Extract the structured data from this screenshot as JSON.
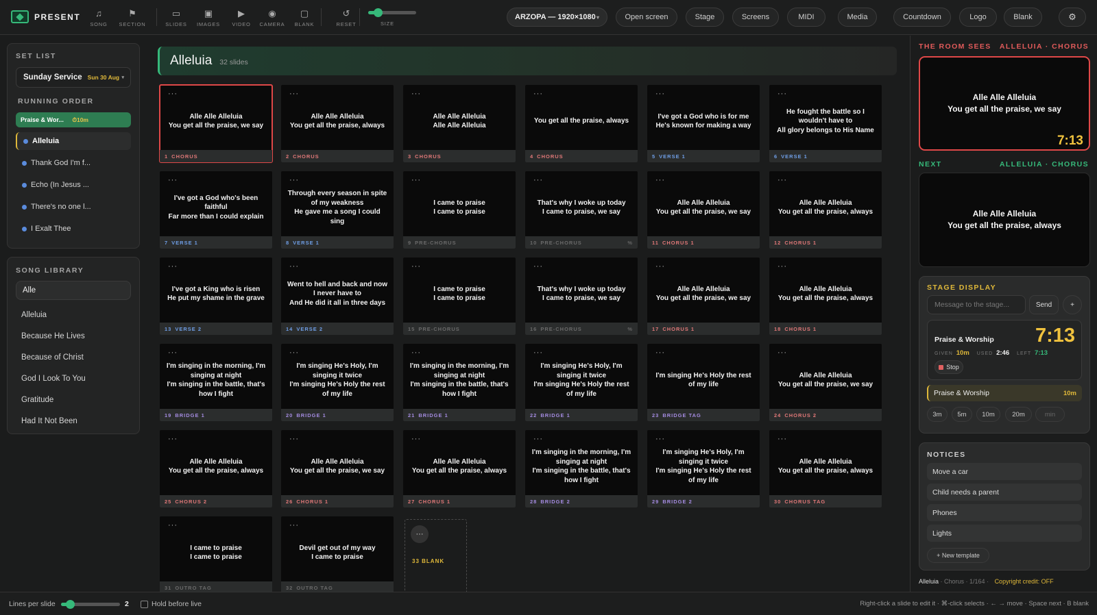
{
  "app": {
    "name": "PRESENT"
  },
  "toolbar": {
    "tools": [
      {
        "icon": "music-note-icon",
        "glyph": "♫",
        "label": "SONG"
      },
      {
        "icon": "flag-icon",
        "glyph": "⚑",
        "label": "SECTION"
      },
      {
        "icon": "monitor-icon",
        "glyph": "▭",
        "label": "SLIDES"
      },
      {
        "icon": "image-icon",
        "glyph": "▣",
        "label": "IMAGES"
      },
      {
        "icon": "video-icon",
        "glyph": "▶",
        "label": "VIDEO"
      },
      {
        "icon": "camera-icon",
        "glyph": "◉",
        "label": "CAMERA"
      },
      {
        "icon": "blank-screen-icon",
        "glyph": "▢",
        "label": "BLANK"
      },
      {
        "icon": "reset-icon",
        "glyph": "↺",
        "label": "RESET"
      }
    ],
    "size_label": "SIZE",
    "size_value": 0.2,
    "display_select": "ARZOPA — 1920×1080",
    "buttons": [
      "Open screen",
      "Stage",
      "Screens",
      "MIDI",
      "Media",
      "Countdown",
      "Logo",
      "Blank"
    ],
    "settings_icon": "gear-icon"
  },
  "setlist": {
    "title": "SET LIST",
    "service": "Sunday Service",
    "service_date": "Sun 30 Aug",
    "running_order_title": "RUNNING ORDER",
    "active_segment": {
      "label": "Praise & Wor...",
      "duration": "⏱10m"
    },
    "items": [
      "Alleluia",
      "Thank God I'm f...",
      "Echo (In Jesus ...",
      "There's no one l...",
      "I Exalt Thee"
    ]
  },
  "library": {
    "title": "SONG LIBRARY",
    "search_value": "Alle",
    "songs": [
      "Alleluia",
      "Because He Lives",
      "Because of Christ",
      "God I Look To You",
      "Gratitude",
      "Had It Not Been"
    ]
  },
  "song": {
    "title": "Alleluia",
    "count": "32 slides"
  },
  "section_colors": {
    "CHORUS": "#e07878",
    "VERSE": "#6f9ee6",
    "PRE-CHORUS": "#6a6a6a",
    "BRIDGE": "#a48be0",
    "BRIDGE TAG": "#a48be0",
    "CHORUS TAG": "#e07878",
    "OUTRO TAG": "#6a6a6a"
  },
  "slides": [
    {
      "num": "1",
      "section": "CHORUS",
      "kind": "CHORUS",
      "text": "Alle Alle Alleluia\nYou get all the praise, we say"
    },
    {
      "num": "2",
      "section": "CHORUS",
      "kind": "CHORUS",
      "text": "Alle Alle Alleluia\nYou get all the praise, always"
    },
    {
      "num": "3",
      "section": "CHORUS",
      "kind": "CHORUS",
      "text": "Alle Alle Alleluia\nAlle Alle Alleluia"
    },
    {
      "num": "4",
      "section": "CHORUS",
      "kind": "CHORUS",
      "text": "You get all the praise, always"
    },
    {
      "num": "5",
      "section": "VERSE 1",
      "kind": "VERSE",
      "text": "I've got a God who is for me\nHe's known for making a way"
    },
    {
      "num": "6",
      "section": "VERSE 1",
      "kind": "VERSE",
      "text": "He fought the battle so I wouldn't have to\nAll glory belongs to His Name"
    },
    {
      "num": "7",
      "section": "VERSE 1",
      "kind": "VERSE",
      "text": "I've got a God who's been faithful\nFar more than I could explain"
    },
    {
      "num": "8",
      "section": "VERSE 1",
      "kind": "VERSE",
      "text": "Through every season in spite of my weakness\nHe gave me a song I could sing"
    },
    {
      "num": "9",
      "section": "PRE-CHORUS",
      "kind": "PRE-CHORUS",
      "text": "I came to praise\nI came to praise"
    },
    {
      "num": "10",
      "section": "PRE-CHORUS",
      "kind": "PRE-CHORUS",
      "text": "That's why I woke up today\nI came to praise, we say",
      "pct": "%"
    },
    {
      "num": "11",
      "section": "CHORUS 1",
      "kind": "CHORUS",
      "text": "Alle Alle Alleluia\nYou get all the praise, we say"
    },
    {
      "num": "12",
      "section": "CHORUS 1",
      "kind": "CHORUS",
      "text": "Alle Alle Alleluia\nYou get all the praise, always"
    },
    {
      "num": "13",
      "section": "VERSE 2",
      "kind": "VERSE",
      "text": "I've got a King who is risen\nHe put my shame in the grave"
    },
    {
      "num": "14",
      "section": "VERSE 2",
      "kind": "VERSE",
      "text": "Went to hell and back and now I never have to\nAnd He did it all in three days"
    },
    {
      "num": "15",
      "section": "PRE-CHORUS",
      "kind": "PRE-CHORUS",
      "text": "I came to praise\nI came to praise"
    },
    {
      "num": "16",
      "section": "PRE-CHORUS",
      "kind": "PRE-CHORUS",
      "text": "That's why I woke up today\nI came to praise, we say",
      "pct": "%"
    },
    {
      "num": "17",
      "section": "CHORUS 1",
      "kind": "CHORUS",
      "text": "Alle Alle Alleluia\nYou get all the praise, we say"
    },
    {
      "num": "18",
      "section": "CHORUS 1",
      "kind": "CHORUS",
      "text": "Alle Alle Alleluia\nYou get all the praise, always"
    },
    {
      "num": "19",
      "section": "BRIDGE 1",
      "kind": "BRIDGE",
      "text": "I'm singing in the morning, I'm singing at night\nI'm singing in the battle, that's how I fight"
    },
    {
      "num": "20",
      "section": "BRIDGE 1",
      "kind": "BRIDGE",
      "text": "I'm singing He's Holy, I'm singing it twice\nI'm singing He's Holy the rest of my life"
    },
    {
      "num": "21",
      "section": "BRIDGE 1",
      "kind": "BRIDGE",
      "text": "I'm singing in the morning, I'm singing at night\nI'm singing in the battle, that's how I fight"
    },
    {
      "num": "22",
      "section": "BRIDGE 1",
      "kind": "BRIDGE",
      "text": "I'm singing He's Holy, I'm singing it twice\nI'm singing He's Holy the rest of my life"
    },
    {
      "num": "23",
      "section": "BRIDGE TAG",
      "kind": "BRIDGE",
      "text": "I'm singing He's Holy the rest of my life"
    },
    {
      "num": "24",
      "section": "CHORUS 2",
      "kind": "CHORUS",
      "text": "Alle Alle Alleluia\nYou get all the praise, we say"
    },
    {
      "num": "25",
      "section": "CHORUS 2",
      "kind": "CHORUS",
      "text": "Alle Alle Alleluia\nYou get all the praise, always"
    },
    {
      "num": "26",
      "section": "CHORUS 1",
      "kind": "CHORUS",
      "text": "Alle Alle Alleluia\nYou get all the praise, we say"
    },
    {
      "num": "27",
      "section": "CHORUS 1",
      "kind": "CHORUS",
      "text": "Alle Alle Alleluia\nYou get all the praise, always"
    },
    {
      "num": "28",
      "section": "BRIDGE 2",
      "kind": "BRIDGE",
      "text": "I'm singing in the morning, I'm singing at night\nI'm singing in the battle, that's how I fight"
    },
    {
      "num": "29",
      "section": "BRIDGE 2",
      "kind": "BRIDGE",
      "text": "I'm singing He's Holy, I'm singing it twice\nI'm singing He's Holy the rest of my life"
    },
    {
      "num": "30",
      "section": "CHORUS TAG",
      "kind": "CHORUS",
      "text": "Alle Alle Alleluia\nYou get all the praise, always"
    },
    {
      "num": "31",
      "section": "OUTRO TAG",
      "kind": "PRE-CHORUS",
      "text": "I came to praise\nI came to praise"
    },
    {
      "num": "32",
      "section": "OUTRO TAG",
      "kind": "PRE-CHORUS",
      "text": "Devil get out of my way\nI came to praise"
    }
  ],
  "blank_slide": {
    "label": "33  BLANK"
  },
  "live": {
    "label": "THE ROOM SEES",
    "section": "ALLELUIA · CHORUS",
    "text": "Alle Alle Alleluia\nYou get all the praise, we say",
    "timer": "7:13"
  },
  "next": {
    "label": "NEXT",
    "section": "ALLELUIA · CHORUS",
    "text": "Alle Alle Alleluia\nYou get all the praise, always"
  },
  "stage": {
    "title": "STAGE DISPLAY",
    "message_placeholder": "Message to the stage...",
    "send": "Send",
    "add": "+",
    "countdown": {
      "title": "Praise & Worship",
      "time": "7:13",
      "given_label": "GIVEN",
      "given": "10m",
      "used_label": "USED",
      "used": "2:46",
      "left_label": "LEFT",
      "left": "7:13",
      "stop": "Stop"
    },
    "segment": {
      "label": "Praise & Worship",
      "duration": "10m"
    },
    "presets": [
      "3m",
      "5m",
      "10m",
      "20m"
    ],
    "custom_placeholder": "min"
  },
  "notices": {
    "title": "NOTICES",
    "items": [
      "Move a car",
      "Child needs a parent",
      "Phones",
      "Lights"
    ],
    "new_template": "+ New template"
  },
  "status": {
    "song": "Alleluia",
    "detail": " · Chorus · 1/164 · ",
    "credit": "Copyright credit: OFF"
  },
  "footer": {
    "lines_label": "Lines per slide",
    "lines_value": "2",
    "hold_label": "Hold before live",
    "hint": "Right-click a slide to edit it · ⌘-click selects · ← → move · Space next · B blank"
  },
  "colors": {
    "accent": "#36b97a",
    "live": "#e04848",
    "gold": "#e0b93a"
  }
}
